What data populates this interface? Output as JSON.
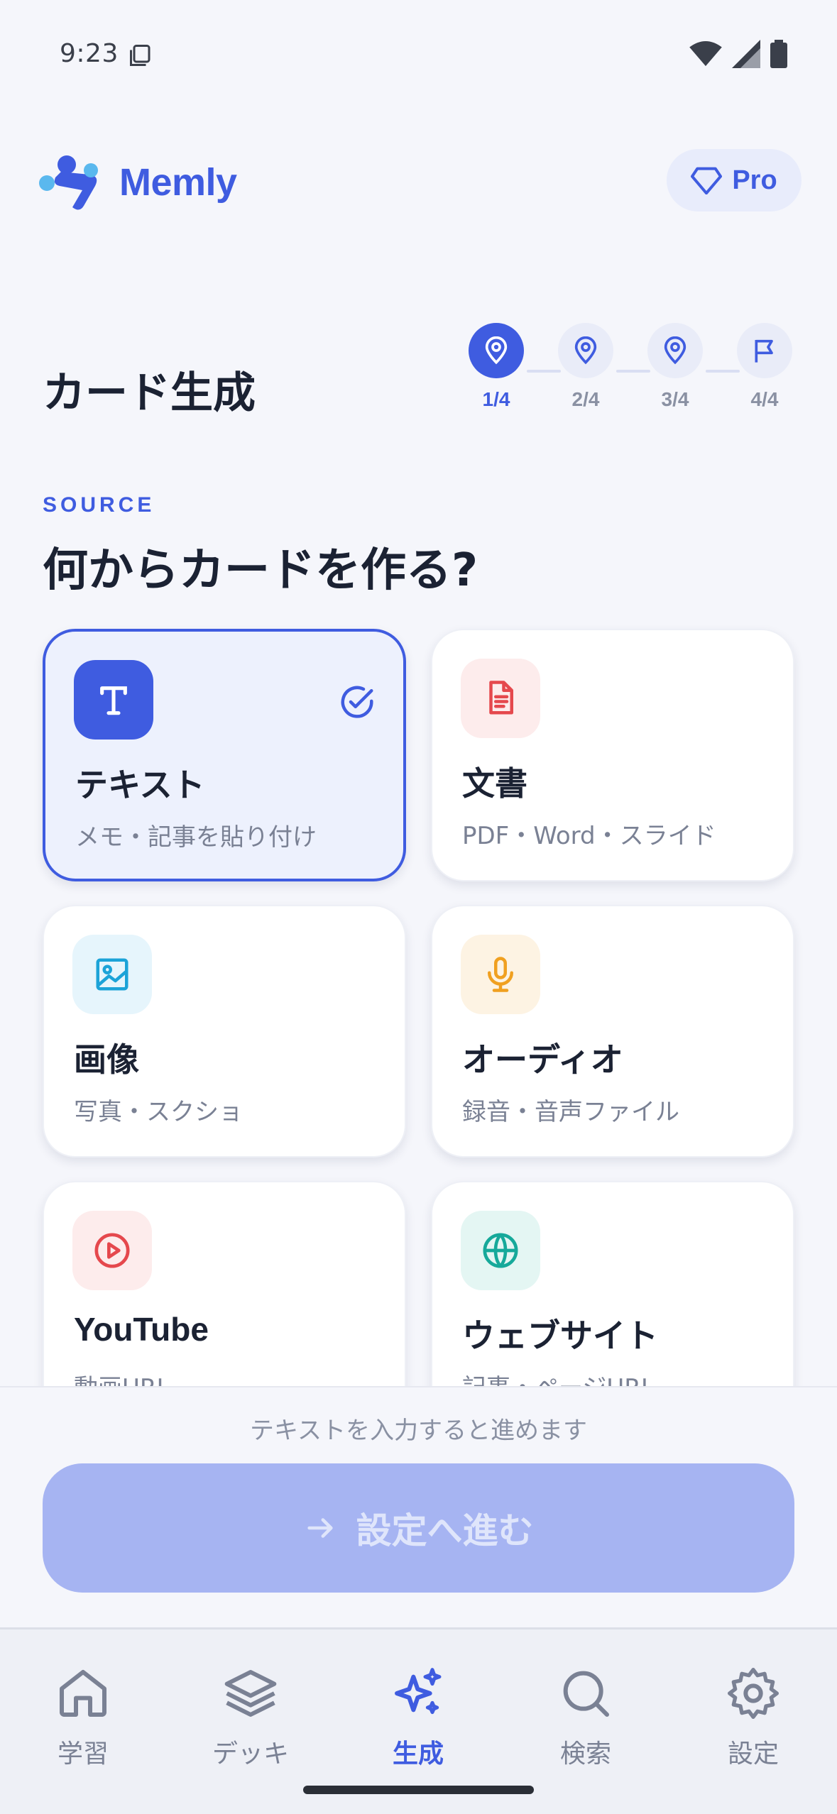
{
  "status": {
    "time": "9:23"
  },
  "app": {
    "name": "Memly",
    "pro_label": "Pro"
  },
  "page": {
    "title": "カード生成"
  },
  "stepper": {
    "steps": [
      {
        "label": "1/4",
        "icon": "location-pin-icon",
        "active": true
      },
      {
        "label": "2/4",
        "icon": "location-pin-icon",
        "active": false
      },
      {
        "label": "3/4",
        "icon": "location-pin-icon",
        "active": false
      },
      {
        "label": "4/4",
        "icon": "flag-icon",
        "active": false
      }
    ]
  },
  "section": {
    "label": "SOURCE",
    "title": "何からカードを作る?"
  },
  "sources": [
    {
      "title": "テキスト",
      "subtitle": "メモ・記事を貼り付け",
      "icon": "text-icon",
      "selected": true,
      "color": "#3f5ce0"
    },
    {
      "title": "文書",
      "subtitle": "PDF・Word・スライド",
      "icon": "document-icon",
      "selected": false,
      "color": "#e5484d"
    },
    {
      "title": "画像",
      "subtitle": "写真・スクショ",
      "icon": "image-icon",
      "selected": false,
      "color": "#1ca3d8"
    },
    {
      "title": "オーディオ",
      "subtitle": "録音・音声ファイル",
      "icon": "microphone-icon",
      "selected": false,
      "color": "#f0a020"
    },
    {
      "title": "YouTube",
      "subtitle": "動画URL",
      "icon": "play-circle-icon",
      "selected": false,
      "color": "#e5484d"
    },
    {
      "title": "ウェブサイト",
      "subtitle": "記事・ページURL",
      "icon": "globe-icon",
      "selected": false,
      "color": "#16a99a"
    }
  ],
  "footer": {
    "hint": "テキストを入力すると進めます",
    "next_button_label": "設定へ進む"
  },
  "nav": {
    "items": [
      {
        "label": "学習",
        "icon": "home-icon",
        "active": false
      },
      {
        "label": "デッキ",
        "icon": "layers-icon",
        "active": false
      },
      {
        "label": "生成",
        "icon": "sparkles-icon",
        "active": true
      },
      {
        "label": "検索",
        "icon": "search-icon",
        "active": false
      },
      {
        "label": "設定",
        "icon": "gear-icon",
        "active": false
      }
    ]
  },
  "colors": {
    "accent": "#3f5ce0",
    "button_disabled": "#a6b4f2"
  }
}
